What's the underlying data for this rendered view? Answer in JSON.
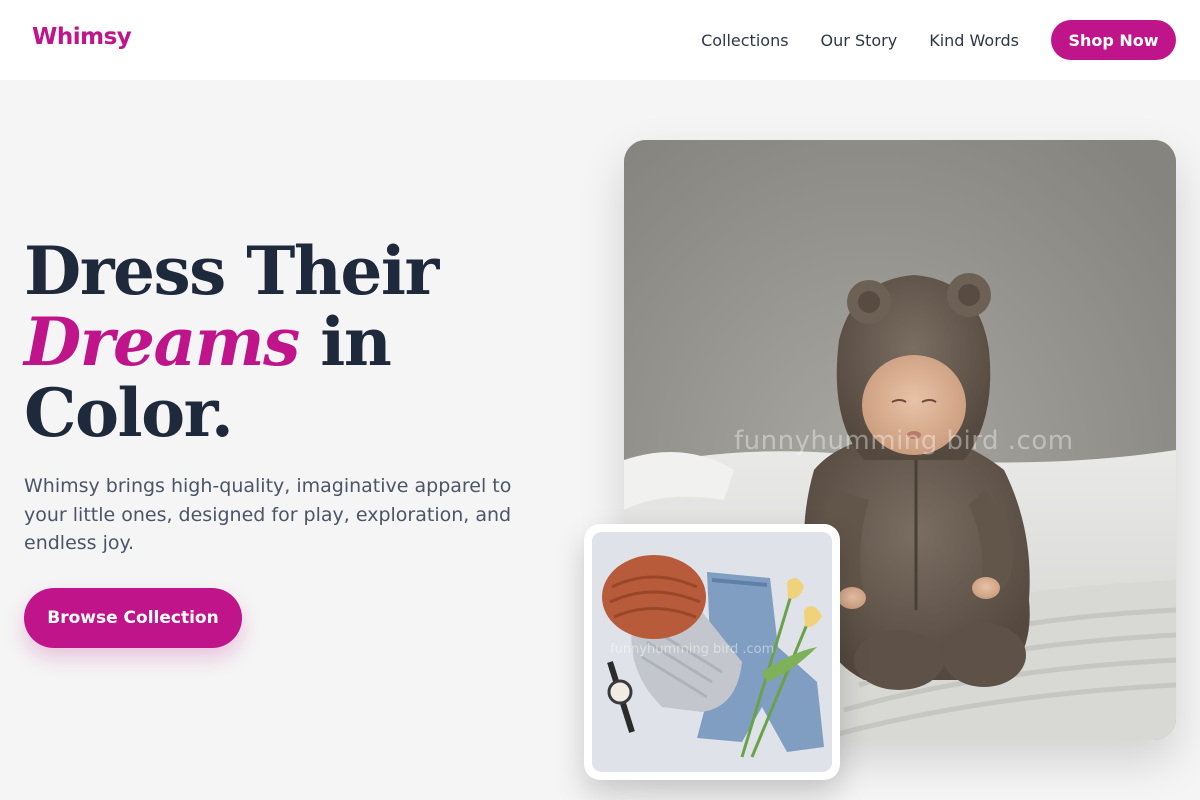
{
  "brand": {
    "name": "Whimsy",
    "accent_color": "#c0158a",
    "dark_text_color": "#1e293b"
  },
  "nav": {
    "links": [
      "Collections",
      "Our Story",
      "Kind Words"
    ],
    "cta_label": "Shop Now"
  },
  "hero": {
    "title_line1": "Dress Their",
    "title_accent": "Dreams",
    "title_line2_rest": " in",
    "title_line3": "Color.",
    "body": "Whimsy brings high-quality, imaginative apparel to your little ones, designed for play, exploration, and endless joy.",
    "cta_label": "Browse Collection"
  },
  "images": {
    "main_watermark": "funnyhumming bird .com",
    "inset_watermark": "funnyhumming bird .com"
  }
}
